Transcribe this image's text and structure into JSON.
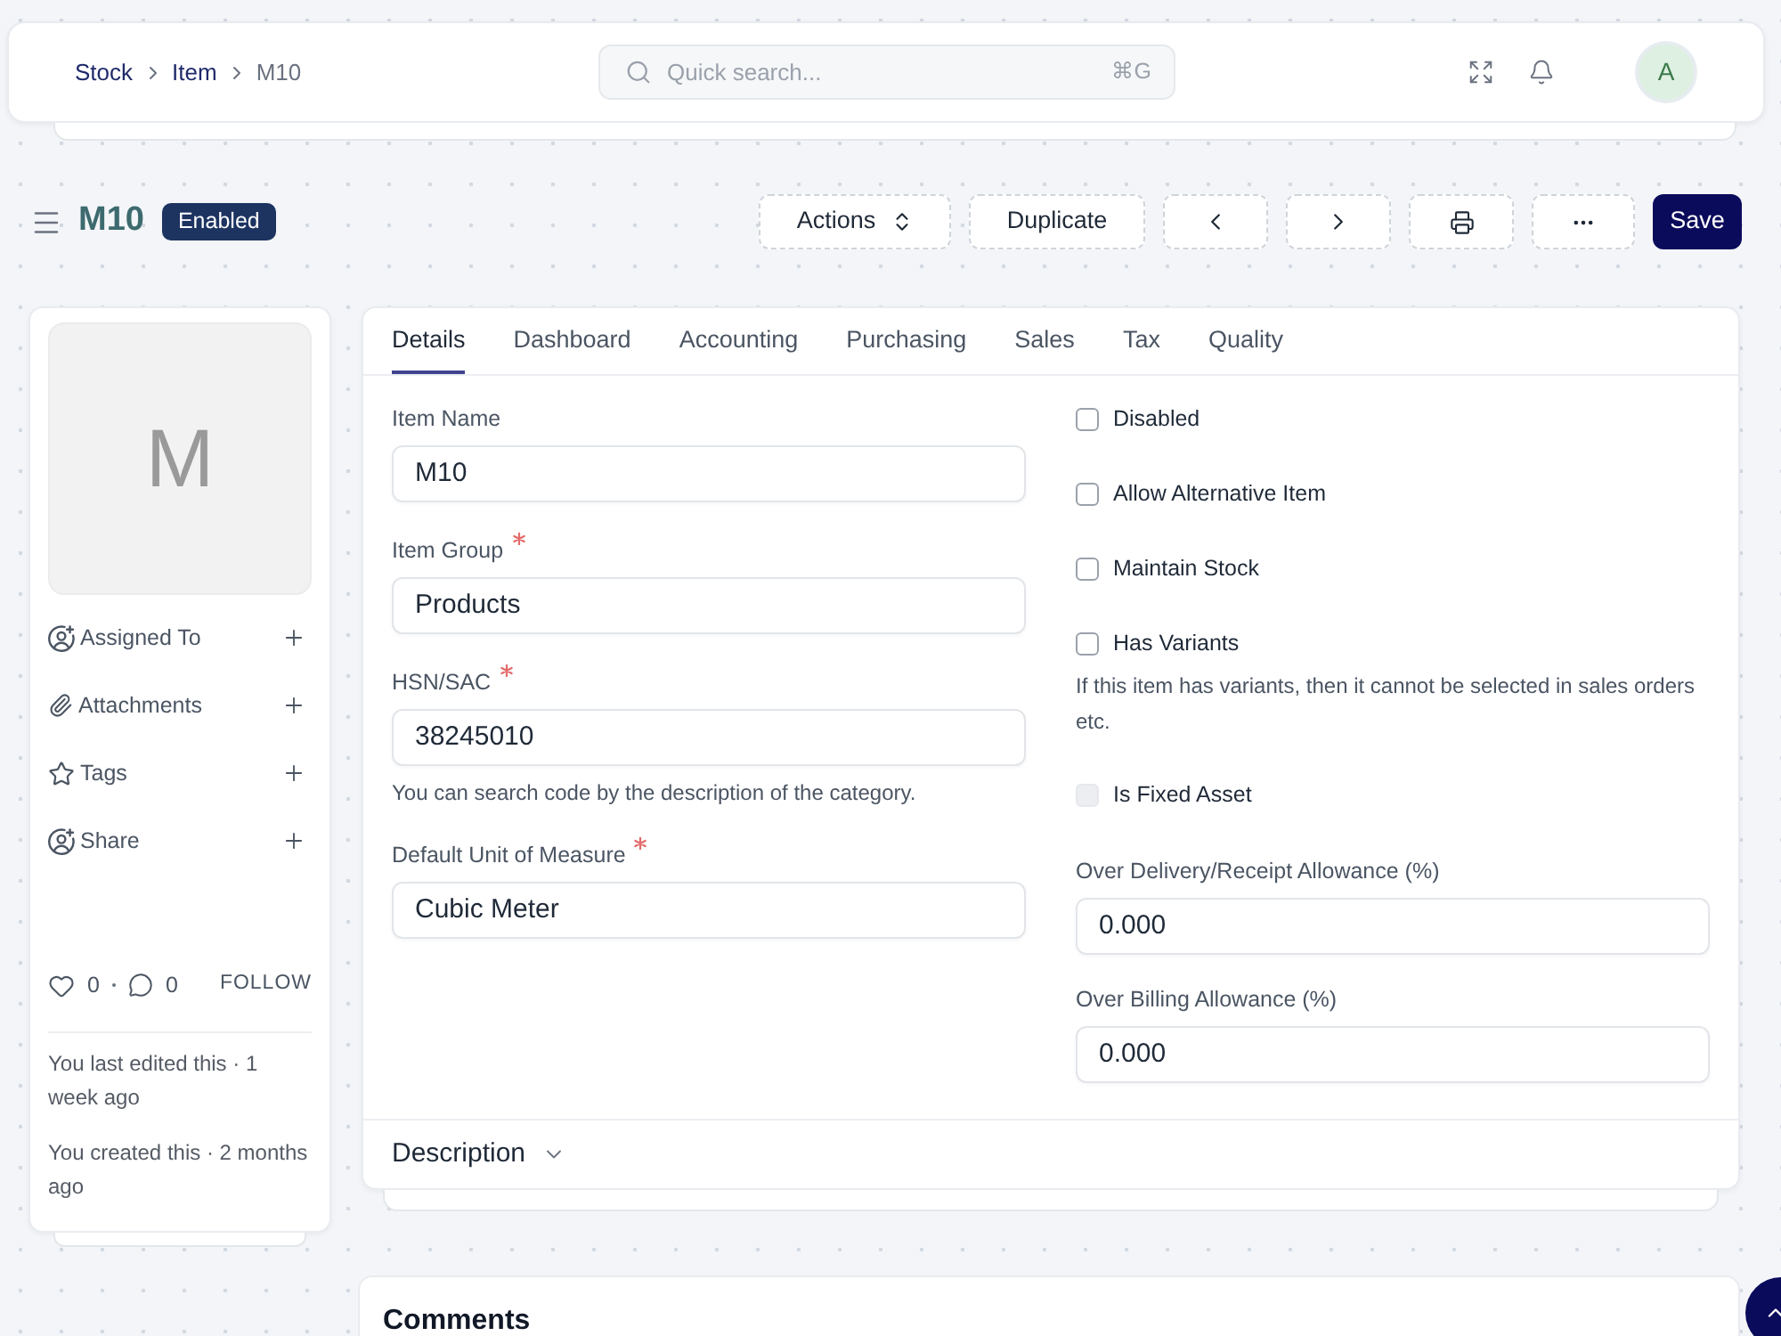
{
  "navbar": {
    "breadcrumbs": [
      {
        "label": "Stock",
        "current": false
      },
      {
        "label": "Item",
        "current": false
      },
      {
        "label": "M10",
        "current": true
      }
    ],
    "search": {
      "placeholder": "Quick search...",
      "shortcut": "⌘G"
    },
    "avatar": "A"
  },
  "header": {
    "title": "M10",
    "status": "Enabled",
    "buttons": [
      {
        "kind": "dropdown",
        "label": "Actions"
      },
      {
        "kind": "text",
        "label": "Duplicate"
      },
      {
        "kind": "previous"
      },
      {
        "kind": "next"
      },
      {
        "kind": "print"
      },
      {
        "kind": "more"
      },
      {
        "kind": "primary",
        "label": "Save"
      }
    ]
  },
  "sidebar": {
    "image_letter": "M",
    "actions": [
      {
        "kind": "assign",
        "label": "Assigned To"
      },
      {
        "kind": "attach",
        "label": "Attachments"
      },
      {
        "kind": "tag",
        "label": "Tags"
      },
      {
        "kind": "share",
        "label": "Share"
      }
    ],
    "likes": "0",
    "comments": "0",
    "follow": "FOLLOW",
    "activity": [
      "You last edited this · 1 week ago",
      "You created this · 2 months ago"
    ]
  },
  "tabs": [
    {
      "label": "Details",
      "selected": true
    },
    {
      "label": "Dashboard",
      "selected": false
    },
    {
      "label": "Accounting",
      "selected": false
    },
    {
      "label": "Purchasing",
      "selected": false
    },
    {
      "label": "Sales",
      "selected": false
    },
    {
      "label": "Tax",
      "selected": false
    },
    {
      "label": "Quality",
      "selected": false
    }
  ],
  "form": {
    "left": [
      {
        "kind": "field",
        "label": "Item Name",
        "required": false,
        "value": "M10"
      },
      {
        "kind": "field",
        "label": "Item Group",
        "required": true,
        "value": "Products"
      },
      {
        "kind": "field",
        "label": "HSN/SAC",
        "required": true,
        "value": "38245010",
        "hint": "You can search code by the description of the category."
      },
      {
        "kind": "field",
        "label": "Default Unit of Measure",
        "required": true,
        "value": "Cubic Meter"
      }
    ],
    "right": [
      {
        "kind": "checkbox",
        "label": "Disabled",
        "checked": false,
        "disabled": false
      },
      {
        "kind": "checkbox",
        "label": "Allow Alternative Item",
        "checked": false,
        "disabled": false
      },
      {
        "kind": "checkbox",
        "label": "Maintain Stock",
        "checked": false,
        "disabled": false
      },
      {
        "kind": "checkbox",
        "label": "Has Variants",
        "checked": false,
        "disabled": false
      },
      {
        "kind": "note",
        "text": "If this item has variants, then it cannot be selected in sales orders etc."
      },
      {
        "kind": "checkbox",
        "label": "Is Fixed Asset",
        "checked": false,
        "disabled": true
      },
      {
        "kind": "field",
        "label": "Over Delivery/Receipt Allowance (%)",
        "required": false,
        "value": "0.000"
      },
      {
        "kind": "field",
        "label": "Over Billing Allowance (%)",
        "required": false,
        "value": "0.000"
      }
    ]
  },
  "description_section": {
    "label": "Description",
    "expanded": false
  },
  "comments": {
    "title": "Comments"
  }
}
